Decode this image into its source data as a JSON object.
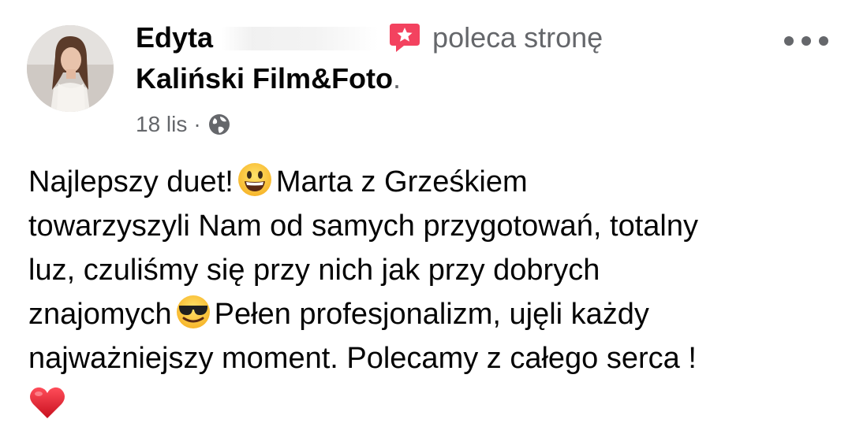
{
  "author": {
    "name": "Edyta",
    "action_text": "poleca stronę",
    "page_name": "Kaliński Film&Foto",
    "page_name_suffix": "."
  },
  "meta": {
    "date": "18 lis",
    "separator": "·",
    "privacy_icon": "globe-icon"
  },
  "icons": {
    "recommend": "recommendation-icon",
    "more": "more-options-icon"
  },
  "colors": {
    "secondary_text": "#65676b",
    "recommend_badge": "#f3425f"
  },
  "body": {
    "line1_a": "Najlepszy duet!",
    "line1_emoji": "grinning-face-emoji",
    "line1_b": "Marta z Grześkiem",
    "line2": "towarzyszyli Nam od samych przygotowań, totalny",
    "line3": "luz, czuliśmy się przy nich jak przy dobrych",
    "line4_a": "znajomych",
    "line4_emoji": "smiling-face-with-sunglasses-emoji",
    "line4_b": "Pełen profesjonalizm, ujęli każdy",
    "line5": "najważniejszy moment. Polecamy z całego serca !",
    "line6_emoji": "red-heart-emoji"
  }
}
